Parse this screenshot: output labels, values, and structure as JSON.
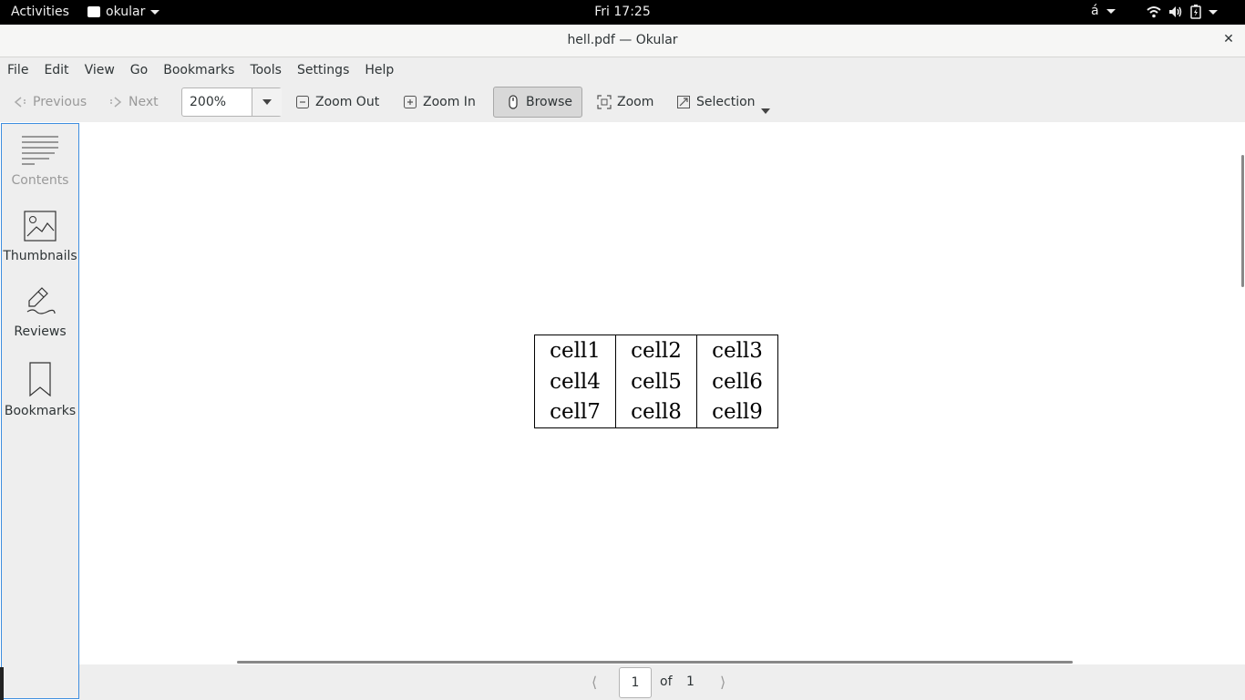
{
  "topbar": {
    "activities": "Activities",
    "app_name": "okular",
    "clock": "Fri 17:25",
    "input_method": "á"
  },
  "window": {
    "title": "hell.pdf — Okular",
    "close_glyph": "✕"
  },
  "menubar": [
    "File",
    "Edit",
    "View",
    "Go",
    "Bookmarks",
    "Tools",
    "Settings",
    "Help"
  ],
  "toolbar": {
    "previous": "Previous",
    "next": "Next",
    "zoom_value": "200%",
    "zoom_out": "Zoom Out",
    "zoom_in": "Zoom In",
    "browse": "Browse",
    "zoom": "Zoom",
    "selection": "Selection"
  },
  "sidebar": {
    "contents": "Contents",
    "thumbnails": "Thumbnails",
    "reviews": "Reviews",
    "bookmarks": "Bookmarks"
  },
  "document": {
    "table": [
      [
        "cell1",
        "cell2",
        "cell3"
      ],
      [
        "cell4",
        "cell5",
        "cell6"
      ],
      [
        "cell7",
        "cell8",
        "cell9"
      ]
    ]
  },
  "pagebar": {
    "current_page": "1",
    "of": "of",
    "total_pages": "1"
  }
}
